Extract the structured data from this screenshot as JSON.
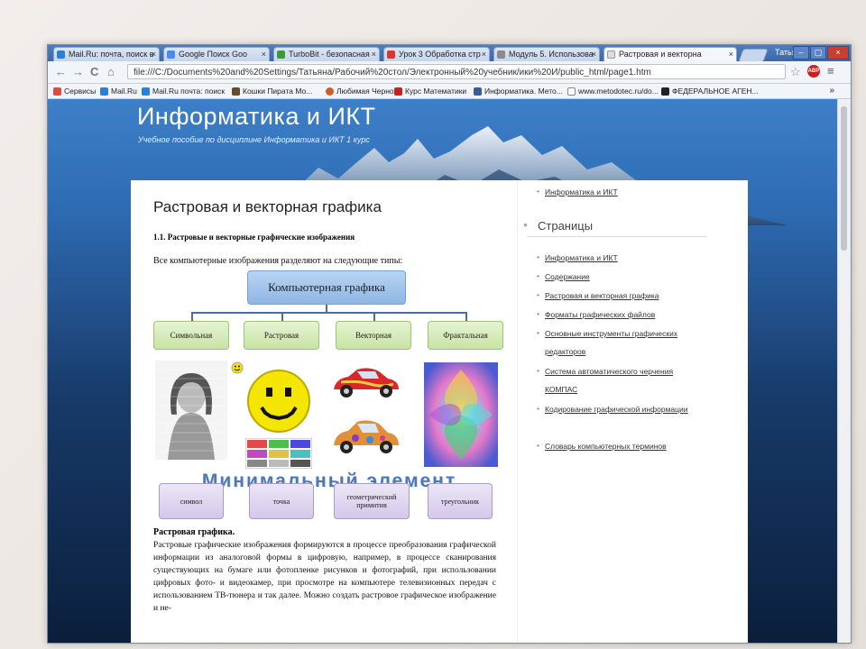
{
  "browser": {
    "tabs": [
      {
        "label": "Mail.Ru: почта, поиск в",
        "color": "#2c7ed6"
      },
      {
        "label": "Google Поиск Goo",
        "color": "#4a8af4"
      },
      {
        "label": "TurboBit - безопасная",
        "color": "#3a9a3a"
      },
      {
        "label": "Урок 3 Обработка стр",
        "color": "#d43a2a"
      },
      {
        "label": "Модуль 5. Использова",
        "color": "#8a8a8a"
      },
      {
        "label": "Растровая и векторна",
        "color": "#dddddd"
      }
    ],
    "close_glyph": "×",
    "user": "Татьяна",
    "window_buttons": [
      "–",
      "▢",
      "×"
    ],
    "back": "←",
    "forward": "→",
    "reload": "C",
    "home": "⌂",
    "address": "file:///C:/Documents%20and%20Settings/Татьяна/Рабочий%20стол/Электронный%20учебник/ики%20И/public_html/page1.htm",
    "star": "☆",
    "adblock": "ABP",
    "menu": "≡",
    "bookmarks": [
      {
        "label": "Сервисы",
        "color": "#e24a3a"
      },
      {
        "label": "Mail.Ru",
        "color": "#2c7ed6"
      },
      {
        "label": "Mail.Ru почта: поиск",
        "color": "#2c7ed6"
      },
      {
        "label": "Кошки Пирата  Мо...",
        "color": "#6b4a2a"
      },
      {
        "label": "Любимая Черно",
        "color": "#d45a20"
      },
      {
        "label": "Курс Математики",
        "color": "#c82020"
      },
      {
        "label": "Информатика. Мето...",
        "color": "#3a5a9a"
      },
      {
        "label": "www.metodotec.ru/do...",
        "color": "#888888"
      },
      {
        "label": "ФЕДЕРАЛЬНОЕ АГЕН...",
        "color": "#222222"
      }
    ],
    "bookmarks_more": "»"
  },
  "site": {
    "title": "Информатика и ИКТ",
    "subtitle": "Учебное пособие по дисциплине Информатика и ИКТ 1 курс"
  },
  "article": {
    "title": "Растровая и векторная графика",
    "section": "1.1. Растровые и векторные графические изображения",
    "intro": "Все компьютерные изображения разделяют на следующие типы:",
    "diagram": {
      "top": "Компьютерная графика",
      "types": [
        "Символьная",
        "Растровая",
        "Векторная",
        "Фрактальная"
      ],
      "banner": "Минимальный элемент",
      "elements": [
        "символ",
        "точка",
        "геометрический примитив",
        "треугольник"
      ]
    },
    "raster_heading": "Растровая графика.",
    "raster_text": "Растровые графические изображения формируются в процессе преобразования графической информации из аналоговой формы в цифровую, например, в процессе сканирования существующих на бумаге или фотопленке рисунков и фотографий, при использовании цифровых фото- и видеокамер, при просмотре на компьютере телевизионных передач с использованием ТВ-тюнера и так далее. Можно создать растровое графическое изображение и не-"
  },
  "sidebar": {
    "top_link": "Информатика и ИКТ",
    "pages_heading": "Страницы",
    "pages": [
      "Информатика и ИКТ",
      "Содержание",
      "Растровая и векторная графика",
      "Форматы графических файлов",
      "Основные инструменты графических редакторов",
      "Система автоматического черчения КОМПАС",
      "Кодирование графической информации",
      "Словарь компьютерных терминов"
    ]
  },
  "colors": {
    "page_bg_top": "#3d7fc8",
    "page_bg_bottom": "#0b1f3c",
    "diagram_top": "#a6c8ee",
    "diagram_mid": "#d6ecba",
    "diagram_bottom": "#ddd3ef"
  }
}
